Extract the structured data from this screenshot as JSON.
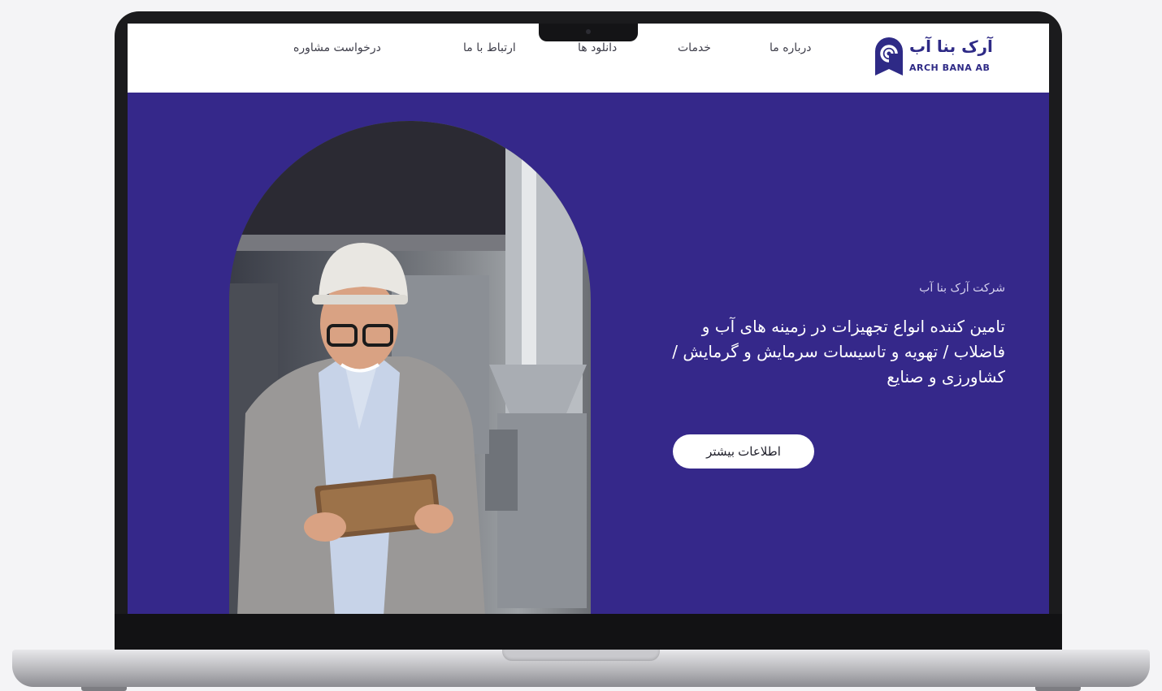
{
  "nav": {
    "logo_fa": "آرک بنا آب",
    "logo_en": "ARCH BANA AB",
    "items": [
      "درباره ما",
      "خدمات",
      "دانلود ها",
      "ارتباط با ما",
      "درخواست مشاوره"
    ]
  },
  "hero": {
    "company_label": "شرکت آرک بنا آب",
    "title": "تامین کننده انواع تجهیزات در زمینه های آب و فاضلاب / تهویه و تاسیسات سرمایش و گرمایش / کشاورزی و صنایع",
    "cta_label": "اطلاعات بیشتر"
  },
  "colors": {
    "hero_background": "#35288a",
    "brand": "#2e2a86",
    "button_background": "#ffffff"
  },
  "icons": {
    "logo": "arch-bana-ab-logo-icon"
  }
}
